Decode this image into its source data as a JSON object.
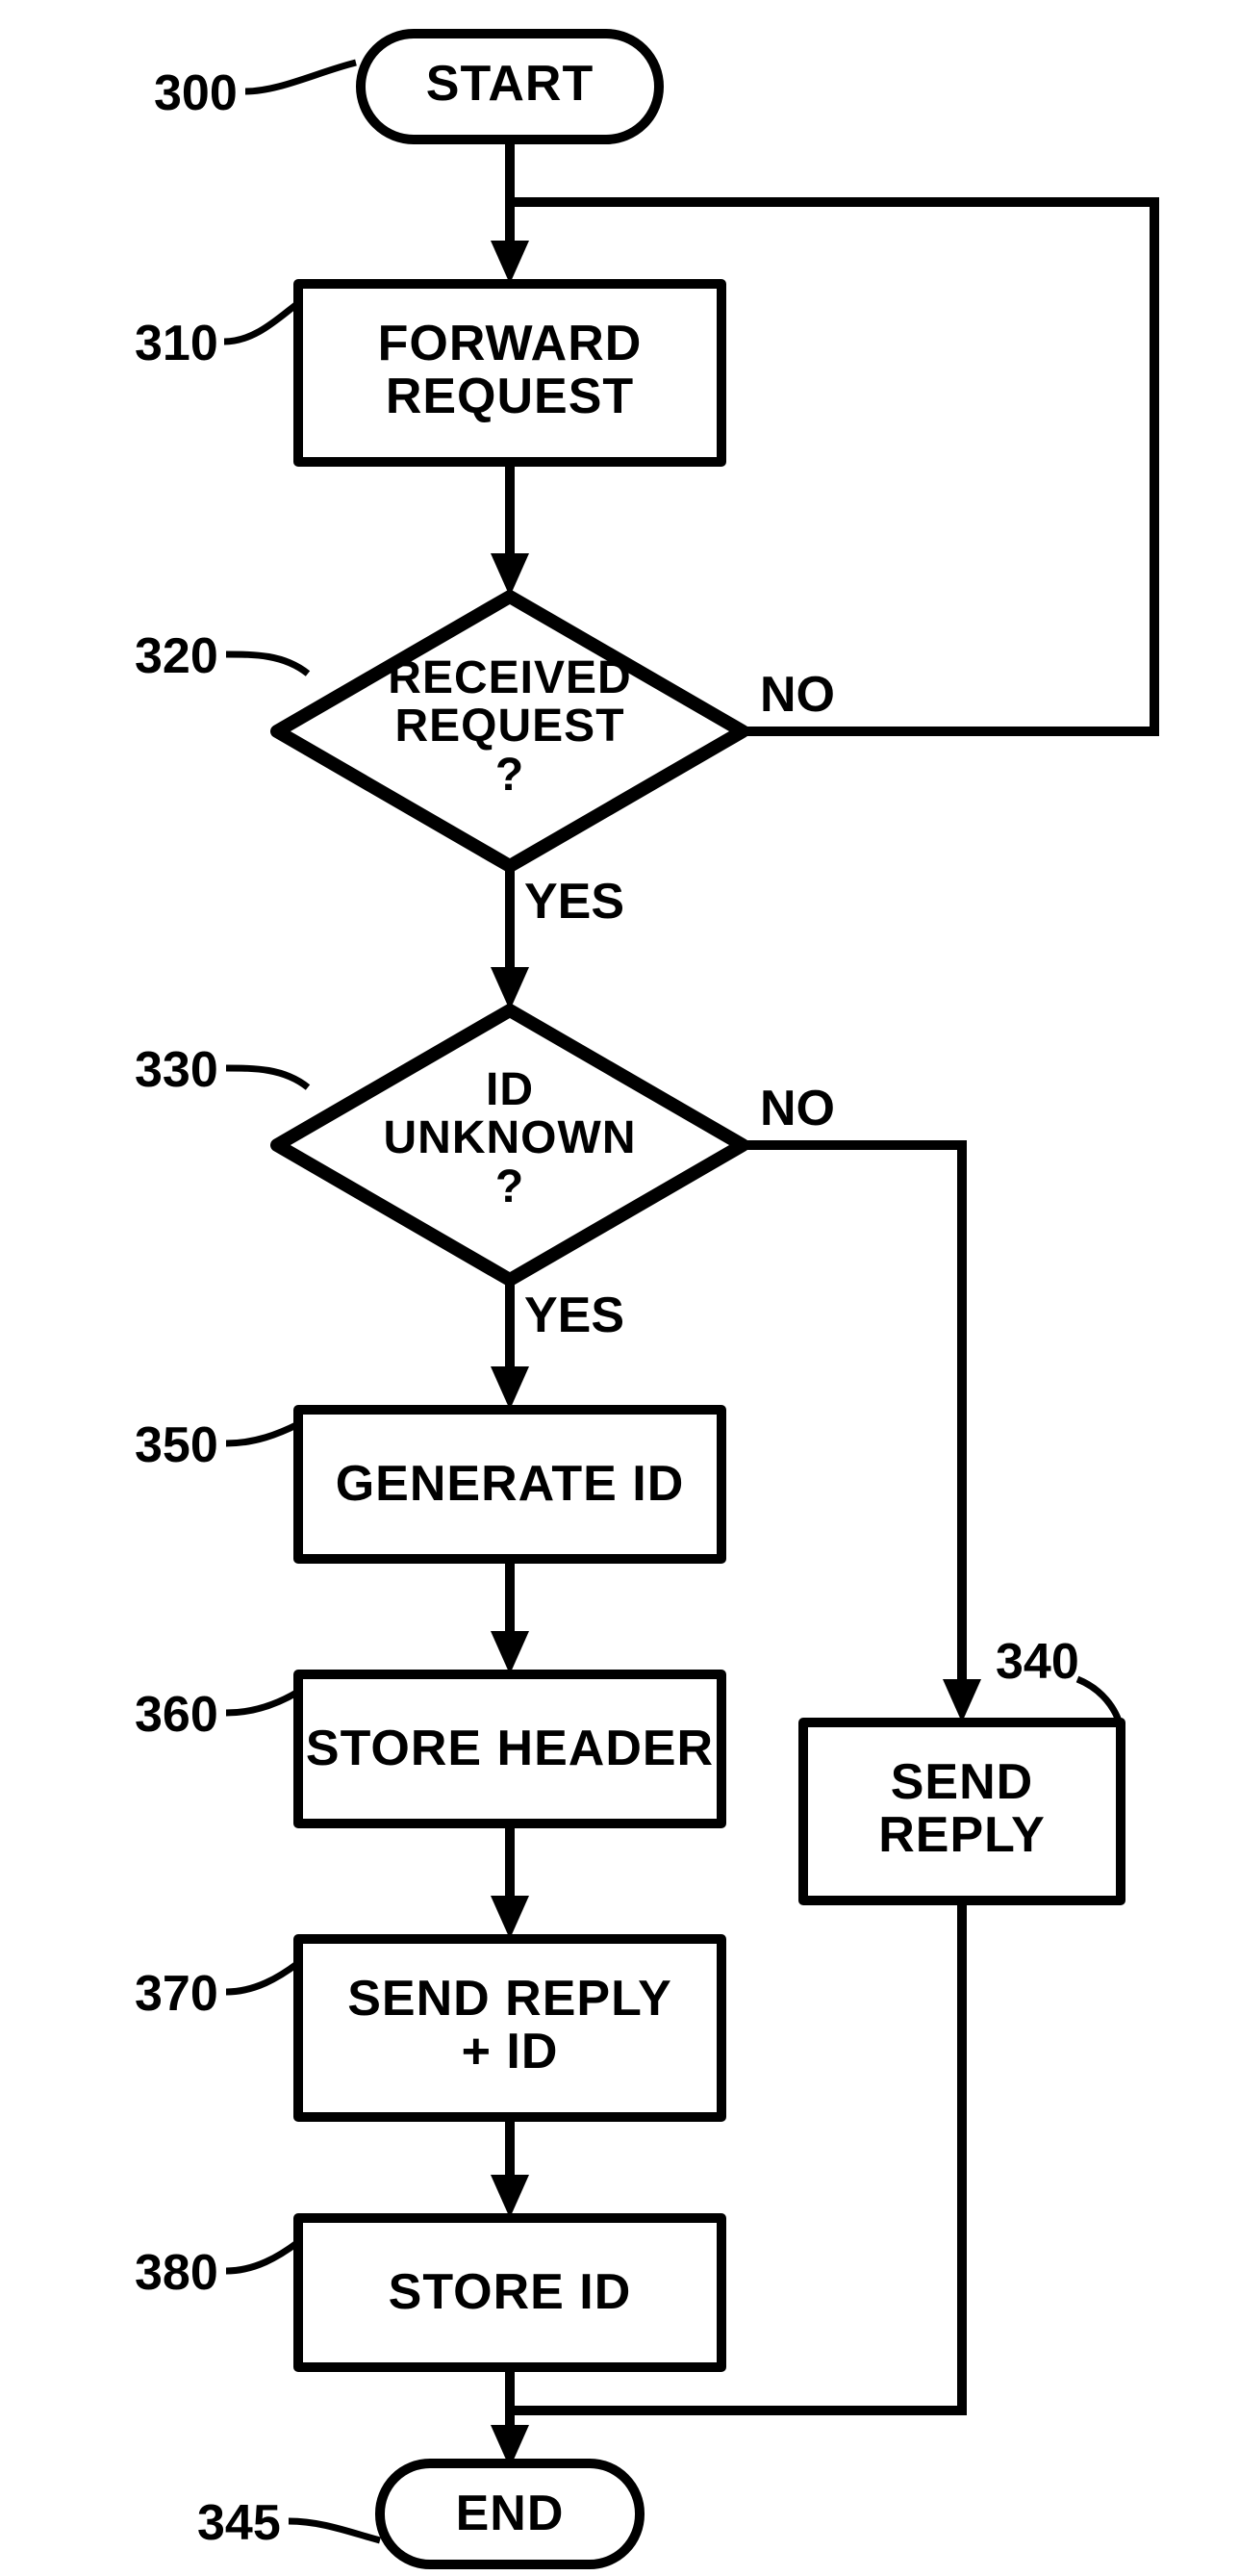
{
  "chart_data": {
    "type": "flowchart",
    "nodes": [
      {
        "id": "start",
        "ref": "300",
        "kind": "terminator",
        "text": "START"
      },
      {
        "id": "fwd",
        "ref": "310",
        "kind": "process",
        "text": "FORWARD\nREQUEST"
      },
      {
        "id": "recvq",
        "ref": "320",
        "kind": "decision",
        "text": "RECEIVED\nREQUEST\n?"
      },
      {
        "id": "idq",
        "ref": "330",
        "kind": "decision",
        "text": "ID\nUNKNOWN\n?"
      },
      {
        "id": "gen",
        "ref": "350",
        "kind": "process",
        "text": "GENERATE ID"
      },
      {
        "id": "sthdr",
        "ref": "360",
        "kind": "process",
        "text": "STORE HEADER"
      },
      {
        "id": "srid",
        "ref": "370",
        "kind": "process",
        "text": "SEND REPLY\n+ ID"
      },
      {
        "id": "stid",
        "ref": "380",
        "kind": "process",
        "text": "STORE ID"
      },
      {
        "id": "sreply",
        "ref": "340",
        "kind": "process",
        "text": "SEND\nREPLY"
      },
      {
        "id": "end",
        "ref": "345",
        "kind": "terminator",
        "text": "END"
      }
    ],
    "edges": [
      {
        "from": "start",
        "to": "fwd",
        "label": ""
      },
      {
        "from": "fwd",
        "to": "recvq",
        "label": ""
      },
      {
        "from": "recvq",
        "to": "idq",
        "label": "YES"
      },
      {
        "from": "recvq",
        "to": "fwd",
        "label": "NO",
        "note": "loop back"
      },
      {
        "from": "idq",
        "to": "gen",
        "label": "YES"
      },
      {
        "from": "idq",
        "to": "sreply",
        "label": "NO"
      },
      {
        "from": "gen",
        "to": "sthdr",
        "label": ""
      },
      {
        "from": "sthdr",
        "to": "srid",
        "label": ""
      },
      {
        "from": "srid",
        "to": "stid",
        "label": ""
      },
      {
        "from": "stid",
        "to": "end",
        "label": ""
      },
      {
        "from": "sreply",
        "to": "end",
        "label": ""
      }
    ]
  },
  "labels": {
    "yes": "YES",
    "no": "NO"
  }
}
